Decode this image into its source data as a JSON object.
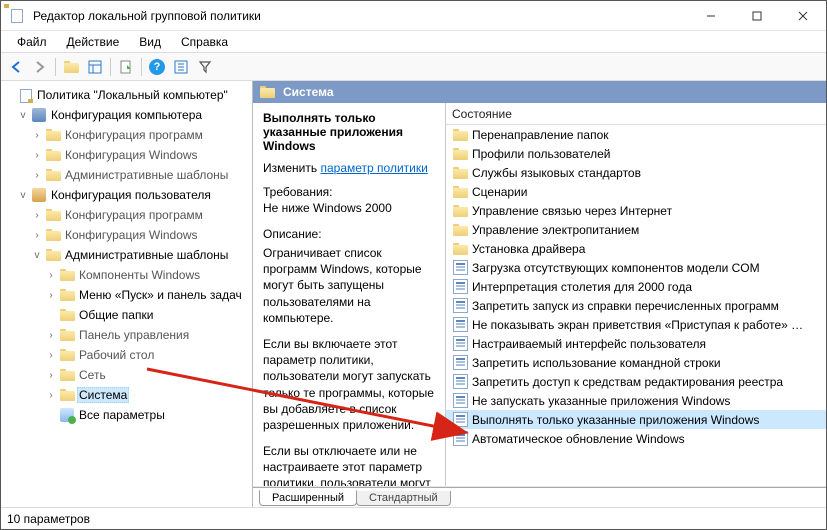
{
  "window": {
    "title": "Редактор локальной групповой политики"
  },
  "menu": {
    "file": "Файл",
    "action": "Действие",
    "view": "Вид",
    "help": "Справка"
  },
  "tree": {
    "root": "Политика \"Локальный компьютер\"",
    "computerConfig": "Конфигурация компьютера",
    "softwareSettingsC": "Конфигурация программ",
    "windowsSettingsC": "Конфигурация Windows",
    "adminTemplatesC": "Административные шаблоны",
    "userConfig": "Конфигурация пользователя",
    "softwareSettingsU": "Конфигурация программ",
    "windowsSettingsU": "Конфигурация Windows",
    "adminTemplatesU": "Административные шаблоны",
    "componentsW": "Компоненты Windows",
    "startMenu": "Меню «Пуск» и панель задач",
    "sharedFolders": "Общие папки",
    "controlPanel": "Панель управления",
    "desktop": "Рабочий стол",
    "network": "Сеть",
    "system": "Система",
    "allSettings": "Все параметры"
  },
  "paneHeader": "Система",
  "desc": {
    "title": "Выполнять только указанные приложения Windows",
    "editLabel": "Изменить",
    "editLink": "параметр политики",
    "reqLabel": "Требования:",
    "reqValue": "Не ниже Windows 2000",
    "descLabel": "Описание:",
    "p1": "Ограничивает список программ Windows, которые могут быть запущены пользователями на компьютере.",
    "p2": "Если вы включаете этот параметр политики, пользователи могут запускать только те программы, которые вы добавляете в список разрешенных приложений.",
    "p3": "Если вы отключаете или не настраиваете этот параметр политики, пользователи могут"
  },
  "listHeader": "Состояние",
  "folders": [
    "Перенаправление папок",
    "Профили пользователей",
    "Службы языковых стандартов",
    "Сценарии",
    "Управление связью через Интернет",
    "Управление электропитанием",
    "Установка драйвера"
  ],
  "settings": [
    "Загрузка отсутствующих компонентов модели COM",
    "Интерпретация столетия для 2000 года",
    "Запретить запуск из справки перечисленных программ",
    "Не показывать экран приветствия «Приступая к работе» …",
    "Настраиваемый интерфейс пользователя",
    "Запретить использование командной строки",
    "Запретить доступ к средствам редактирования реестра",
    "Не запускать указанные приложения Windows",
    "Выполнять только указанные приложения Windows",
    "Автоматическое обновление Windows"
  ],
  "selectedSettingIndex": 8,
  "tabs": {
    "extended": "Расширенный",
    "standard": "Стандартный"
  },
  "status": "10 параметров"
}
